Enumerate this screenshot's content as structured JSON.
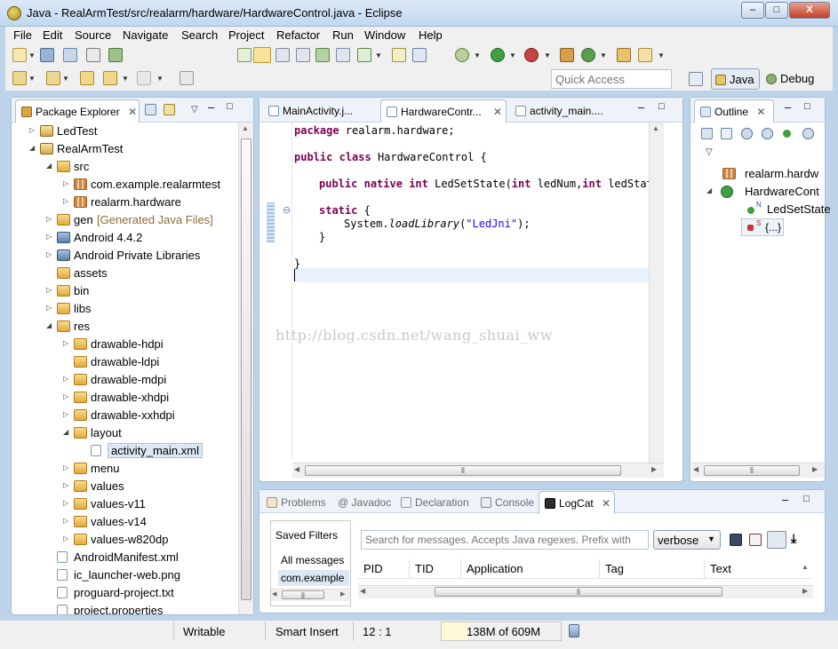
{
  "window": {
    "title": "Java - RealArmTest/src/realarm/hardware/HardwareControl.java - Eclipse",
    "minimize": "–",
    "maximize": "□",
    "close": "X"
  },
  "menu": [
    "File",
    "Edit",
    "Source",
    "Navigate",
    "Search",
    "Project",
    "Refactor",
    "Run",
    "Window",
    "Help"
  ],
  "quick_access": {
    "placeholder": "Quick Access"
  },
  "perspectives": {
    "java": "Java",
    "debug": "Debug"
  },
  "package_explorer": {
    "tab": "Package Explorer",
    "items": [
      {
        "label": "LedTest",
        "depth": 0,
        "type": "project",
        "twisty": "▷"
      },
      {
        "label": "RealArmTest",
        "depth": 0,
        "type": "project",
        "twisty": "◢"
      },
      {
        "label": "src",
        "depth": 1,
        "type": "folder",
        "twisty": "◢"
      },
      {
        "label": "com.example.realarmtest",
        "depth": 2,
        "type": "package",
        "twisty": "▷"
      },
      {
        "label": "realarm.hardware",
        "depth": 2,
        "type": "package",
        "twisty": "▷"
      },
      {
        "label": "gen",
        "depth": 1,
        "type": "folder",
        "twisty": "▷",
        "suffix": "[Generated Java Files]"
      },
      {
        "label": "Android 4.4.2",
        "depth": 1,
        "type": "lib",
        "twisty": "▷"
      },
      {
        "label": "Android Private Libraries",
        "depth": 1,
        "type": "lib",
        "twisty": "▷"
      },
      {
        "label": "assets",
        "depth": 1,
        "type": "folder",
        "twisty": ""
      },
      {
        "label": "bin",
        "depth": 1,
        "type": "folder",
        "twisty": "▷"
      },
      {
        "label": "libs",
        "depth": 1,
        "type": "folder",
        "twisty": "▷"
      },
      {
        "label": "res",
        "depth": 1,
        "type": "folder",
        "twisty": "◢"
      },
      {
        "label": "drawable-hdpi",
        "depth": 2,
        "type": "folder",
        "twisty": "▷"
      },
      {
        "label": "drawable-ldpi",
        "depth": 2,
        "type": "folder",
        "twisty": ""
      },
      {
        "label": "drawable-mdpi",
        "depth": 2,
        "type": "folder",
        "twisty": "▷"
      },
      {
        "label": "drawable-xhdpi",
        "depth": 2,
        "type": "folder",
        "twisty": "▷"
      },
      {
        "label": "drawable-xxhdpi",
        "depth": 2,
        "type": "folder",
        "twisty": "▷"
      },
      {
        "label": "layout",
        "depth": 2,
        "type": "folder",
        "twisty": "◢"
      },
      {
        "label": "activity_main.xml",
        "depth": 3,
        "type": "file",
        "twisty": "",
        "selected": true
      },
      {
        "label": "menu",
        "depth": 2,
        "type": "folder",
        "twisty": "▷"
      },
      {
        "label": "values",
        "depth": 2,
        "type": "folder",
        "twisty": "▷"
      },
      {
        "label": "values-v11",
        "depth": 2,
        "type": "folder",
        "twisty": "▷"
      },
      {
        "label": "values-v14",
        "depth": 2,
        "type": "folder",
        "twisty": "▷"
      },
      {
        "label": "values-w820dp",
        "depth": 2,
        "type": "folder",
        "twisty": "▷"
      },
      {
        "label": "AndroidManifest.xml",
        "depth": 1,
        "type": "file",
        "twisty": ""
      },
      {
        "label": "ic_launcher-web.png",
        "depth": 1,
        "type": "file",
        "twisty": ""
      },
      {
        "label": "proguard-project.txt",
        "depth": 1,
        "type": "file",
        "twisty": ""
      },
      {
        "label": "project.properties",
        "depth": 1,
        "type": "file",
        "twisty": ""
      }
    ]
  },
  "editor": {
    "tabs": [
      "MainActivity.j...",
      "HardwareContr...",
      "activity_main...."
    ],
    "watermark": "http://blog.csdn.net/wang_shuai_ww",
    "code": {
      "l1": [
        "package",
        " realarm.hardware;"
      ],
      "l2": [
        "public",
        " ",
        "class",
        " HardwareControl {"
      ],
      "l3": [
        "public",
        " ",
        "native",
        " ",
        "int",
        " LedSetState(",
        "int",
        " ledNum,",
        "int",
        " ledState"
      ],
      "l4": [
        "static",
        " {"
      ],
      "l5": [
        "System.",
        "loadLibrary",
        "(",
        "\"LedJni\"",
        ");"
      ],
      "l6": "}",
      "l7": "}"
    }
  },
  "outline": {
    "tab": "Outline",
    "items": [
      {
        "label": "realarm.hardw"
      },
      {
        "label": "HardwareCont"
      },
      {
        "label": "LedSetState",
        "marker": "N"
      },
      {
        "label": "{...}",
        "marker": "S"
      }
    ]
  },
  "bottom": {
    "tabs": [
      "Problems",
      "@ Javadoc",
      "Declaration",
      "Console",
      "LogCat"
    ],
    "saved_filters": "Saved Filters",
    "filters": [
      "All messages",
      "com.example"
    ],
    "search_placeholder": "Search for messages. Accepts Java regexes. Prefix with",
    "level": "verbose",
    "columns": [
      "PID",
      "TID",
      "Application",
      "Tag",
      "Text"
    ]
  },
  "status": {
    "writable": "Writable",
    "insert": "Smart Insert",
    "position": "12 : 1",
    "heap": "138M of 609M"
  }
}
